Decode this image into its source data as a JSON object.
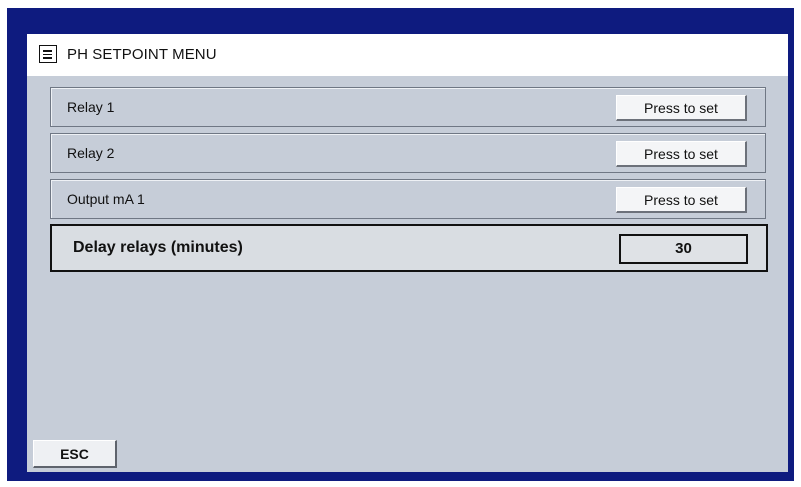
{
  "header": {
    "icon": "menu-list-icon",
    "title": "PH SETPOINT MENU"
  },
  "rows": [
    {
      "label": "Relay 1",
      "button_label": "Press to set"
    },
    {
      "label": "Relay 2",
      "button_label": "Press to set"
    },
    {
      "label": "Output mA 1",
      "button_label": "Press to set"
    }
  ],
  "selected_row": {
    "label": "Delay relays (minutes)",
    "value": "30"
  },
  "footer": {
    "esc_label": "ESC"
  },
  "colors": {
    "frame": "#0e1b7f",
    "panel": "#c6cdd8",
    "header_bg": "#ffffff"
  }
}
